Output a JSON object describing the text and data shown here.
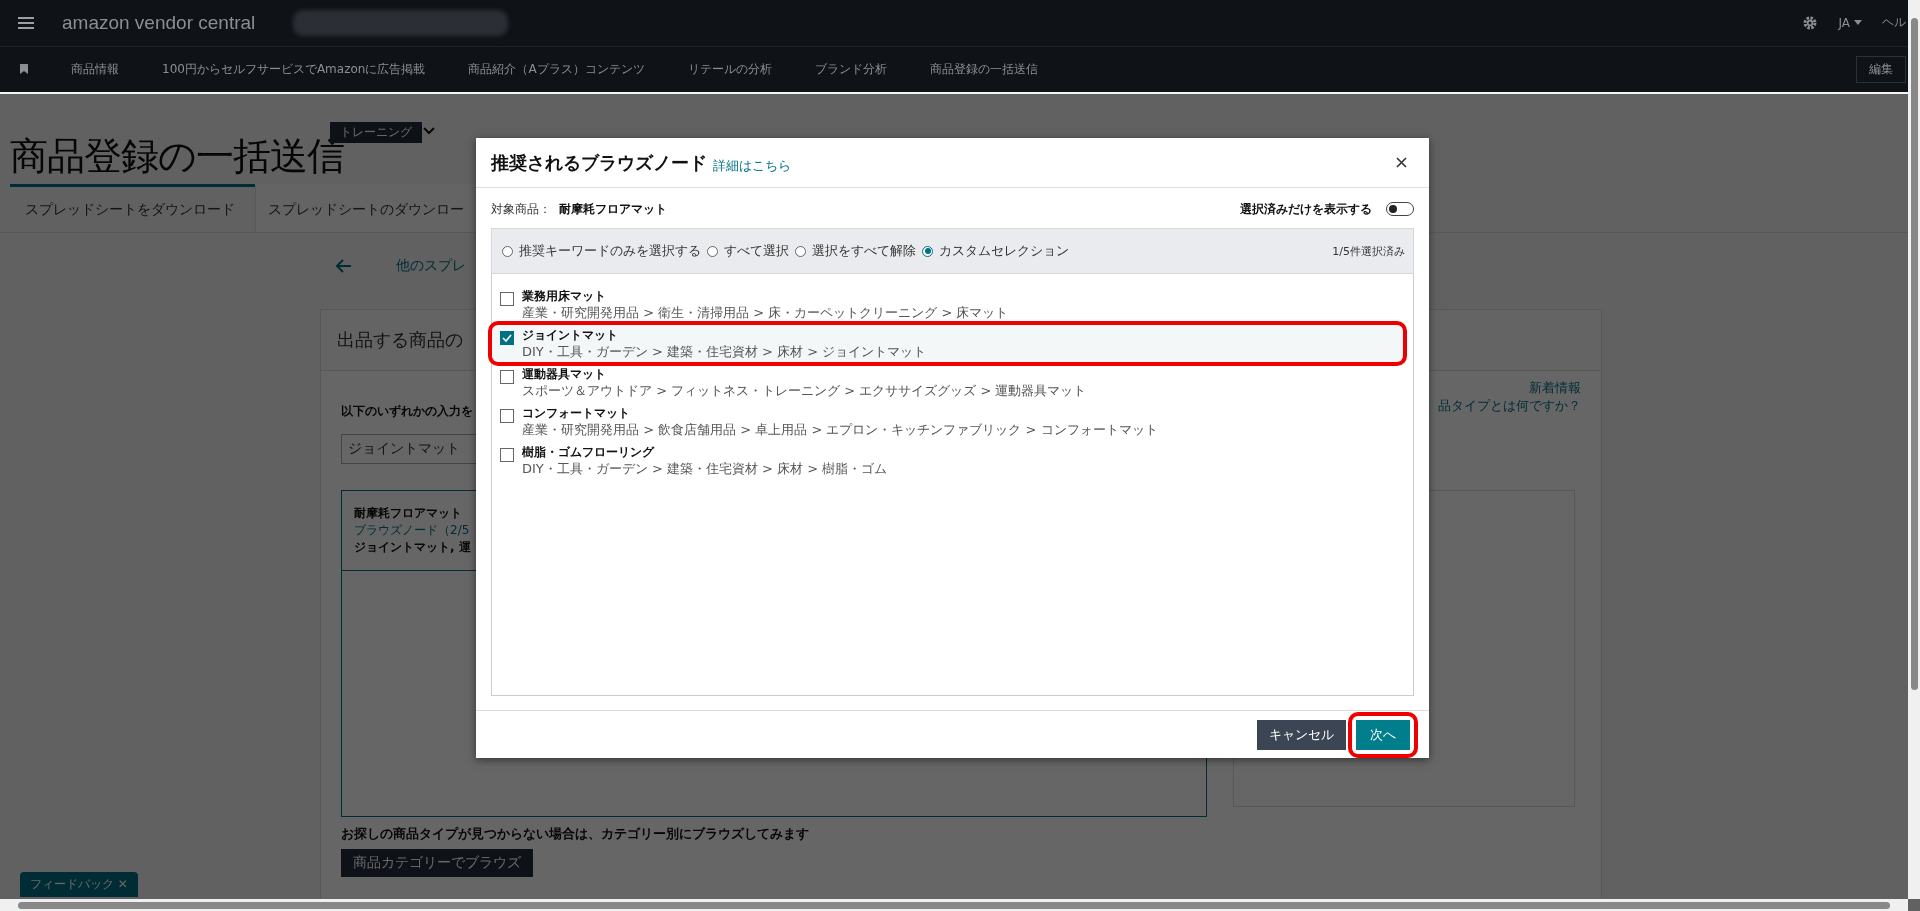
{
  "top_bar": {
    "logo": "amazon vendor central",
    "language": "JA",
    "help": "ヘル"
  },
  "nav": {
    "items": [
      "商品情報",
      "100円からセルフサービスでAmazonに広告掲載",
      "商品紹介（Aプラス）コンテンツ",
      "リテールの分析",
      "ブランド分析",
      "商品登録の一括送信"
    ],
    "edit_button": "編集"
  },
  "page": {
    "badge": "トレーニング",
    "title": "商品登録の一括送信",
    "tabs": [
      {
        "label": "スプレッドシートをダウンロード",
        "selected": true
      },
      {
        "label": "スプレッドシートのダウンロー",
        "selected": false
      }
    ],
    "back_link": "他のスプレ",
    "card_title": "出品する商品の",
    "prompt": "以下のいずれかの入力を",
    "search_value": "ジョイントマット",
    "result": {
      "name": "耐摩耗フロアマット",
      "link": "ブラウズノード（2/5",
      "selection": "ジョイントマット, 運"
    },
    "whats_new": "新着情報",
    "help_link": "品タイプとは何ですか？",
    "not_found": "お探しの商品タイプが見つからない場合は、カテゴリー別にブラウズしてみます",
    "browse_button": "商品カテゴリーでブラウズ",
    "feedback": "フィードバック ✕"
  },
  "modal": {
    "title": "推奨されるブラウズノード",
    "details_link": "詳細はこちら",
    "target_label": "対象商品：",
    "target_value": "耐摩耗フロアマット",
    "show_selected_only": {
      "label": "選択済みだけを表示する",
      "on": false
    },
    "modes": [
      {
        "label": "推奨キーワードのみを選択する",
        "selected": false
      },
      {
        "label": "すべて選択",
        "selected": false
      },
      {
        "label": "選択をすべて解除",
        "selected": false
      },
      {
        "label": "カスタムセレクション",
        "selected": true
      }
    ],
    "count": "1/5件選択済み",
    "nodes": [
      {
        "name": "業務用床マット",
        "path": "産業・研究開発用品 > 衛生・清掃用品 > 床・カーペットクリーニング > 床マット",
        "checked": false,
        "callout": false
      },
      {
        "name": "ジョイントマット",
        "path": "DIY・工具・ガーデン > 建築・住宅資材 > 床材 > ジョイントマット",
        "checked": true,
        "callout": true
      },
      {
        "name": "運動器具マット",
        "path": "スポーツ＆アウトドア > フィットネス・トレーニング > エクササイズグッズ > 運動器具マット",
        "checked": false,
        "callout": false
      },
      {
        "name": "コンフォートマット",
        "path": "産業・研究開発用品 > 飲食店舗用品 > 卓上用品 > エプロン・キッチンファブリック > コンフォートマット",
        "checked": false,
        "callout": false
      },
      {
        "name": "樹脂・ゴムフローリング",
        "path": "DIY・工具・ガーデン > 建築・住宅資材 > 床材 > 樹脂・ゴム",
        "checked": false,
        "callout": false
      }
    ],
    "cancel": "キャンセル",
    "next": {
      "label": "次へ",
      "callout": true
    }
  }
}
